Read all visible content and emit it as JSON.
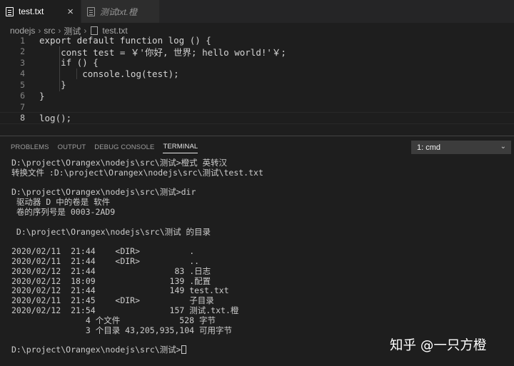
{
  "tabs": [
    {
      "label": "test.txt",
      "close": "×"
    },
    {
      "label": "测试txt.橙"
    }
  ],
  "breadcrumb": [
    "nodejs",
    "src",
    "测试",
    "test.txt"
  ],
  "editor": {
    "lines": [
      {
        "num": "1",
        "text": "export default function log () {"
      },
      {
        "num": "2",
        "text": "    const test = ￥'你好, 世界; hello world!'￥;"
      },
      {
        "num": "3",
        "text": "    if () {"
      },
      {
        "num": "4",
        "text": "        console.log(test);"
      },
      {
        "num": "5",
        "text": "    }"
      },
      {
        "num": "6",
        "text": "}"
      },
      {
        "num": "7",
        "text": ""
      },
      {
        "num": "8",
        "text": "log();"
      }
    ]
  },
  "panel": {
    "tabs": [
      "PROBLEMS",
      "OUTPUT",
      "DEBUG CONSOLE",
      "TERMINAL"
    ],
    "terminal_select": "1: cmd"
  },
  "terminal": {
    "lines": [
      "D:\\project\\Orangex\\nodejs\\src\\测试>橙式 英转汉",
      "转换文件 :D:\\project\\Orangex\\nodejs\\src\\测试\\test.txt",
      "",
      "D:\\project\\Orangex\\nodejs\\src\\测试>dir",
      " 驱动器 D 中的卷是 软件",
      " 卷的序列号是 0003-2AD9",
      "",
      " D:\\project\\Orangex\\nodejs\\src\\测试 的目录",
      "",
      "2020/02/11  21:44    <DIR>          .",
      "2020/02/11  21:44    <DIR>          ..",
      "2020/02/12  21:44                83 .日志",
      "2020/02/12  18:09               139 .配置",
      "2020/02/12  21:44               149 test.txt",
      "2020/02/11  21:45    <DIR>          子目录",
      "2020/02/12  21:54               157 测试.txt.橙",
      "               4 个文件            528 字节",
      "               3 个目录 43,205,935,104 可用字节",
      "",
      "D:\\project\\Orangex\\nodejs\\src\\测试>"
    ]
  },
  "watermark": "知乎 @一只方橙"
}
